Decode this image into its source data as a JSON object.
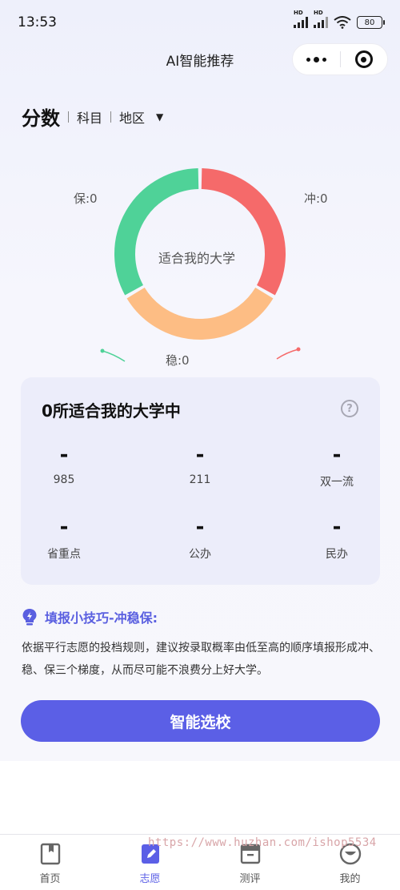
{
  "status_bar": {
    "time": "13:53",
    "battery": "80",
    "hd": "HD"
  },
  "nav": {
    "title": "AI智能推荐"
  },
  "filters": {
    "active": "分数",
    "items": [
      "科目",
      "地区"
    ]
  },
  "chart_data": {
    "type": "pie",
    "center_label": "适合我的大学",
    "slices": [
      {
        "label": "冲:0",
        "color": "#f56a6a"
      },
      {
        "label": "稳:0",
        "color": "#fdbd84"
      },
      {
        "label": "保:0",
        "color": "#4fd298"
      }
    ]
  },
  "stats": {
    "title": "0所适合我的大学中",
    "items": [
      {
        "value": "-",
        "label": "985"
      },
      {
        "value": "-",
        "label": "211"
      },
      {
        "value": "-",
        "label": "双一流"
      },
      {
        "value": "-",
        "label": "省重点"
      },
      {
        "value": "-",
        "label": "公办"
      },
      {
        "value": "-",
        "label": "民办"
      }
    ]
  },
  "tip": {
    "title": "填报小技巧-冲稳保:",
    "body": "依据平行志愿的投档规则，建议按录取概率由低至高的顺序填报形成冲、稳、保三个梯度，从而尽可能不浪费分上好大学。"
  },
  "cta": {
    "label": "智能选校"
  },
  "tabbar": {
    "items": [
      {
        "label": "首页",
        "icon": "book-icon"
      },
      {
        "label": "志愿",
        "icon": "edit-icon"
      },
      {
        "label": "测评",
        "icon": "clipboard-icon"
      },
      {
        "label": "我的",
        "icon": "smile-icon"
      }
    ],
    "active_color": "#5b5fe6"
  },
  "watermark": "https://www.huzhan.com/ishop5534"
}
